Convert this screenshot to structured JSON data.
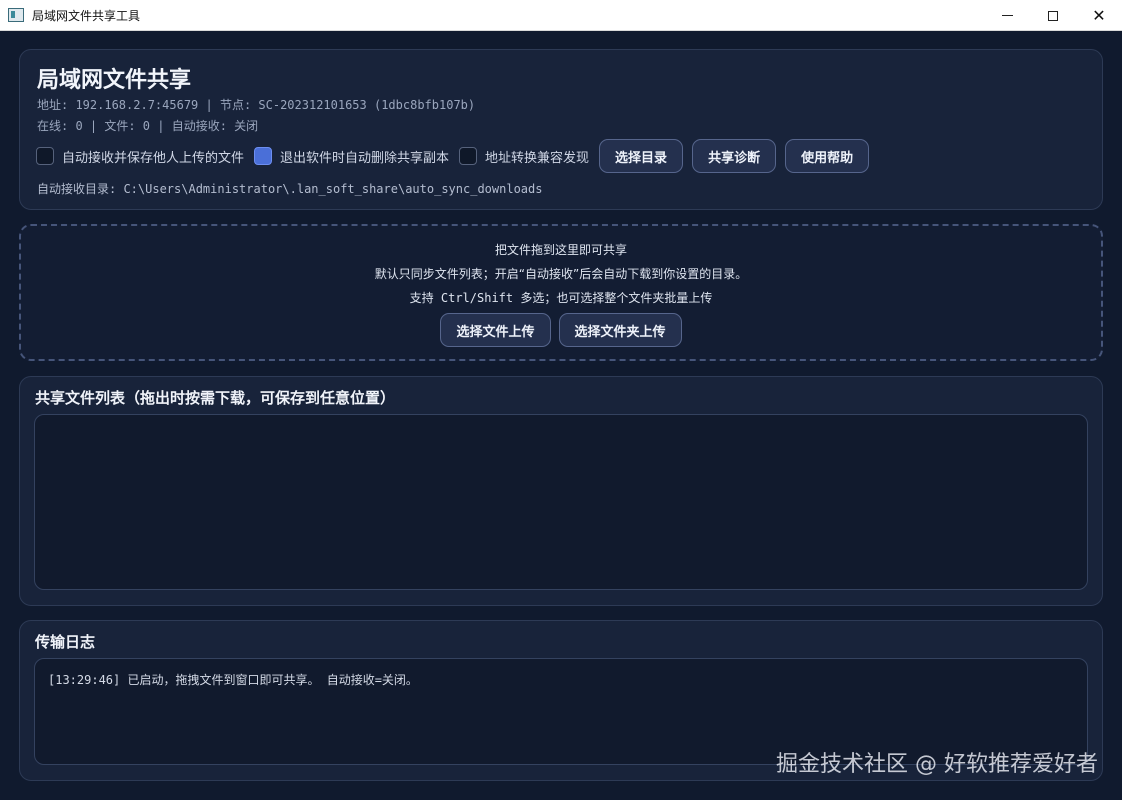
{
  "window": {
    "title": "局域网文件共享工具",
    "controls": {
      "minimize": "—",
      "maximize": "☐",
      "close": "✕"
    }
  },
  "header": {
    "title": "局域网文件共享",
    "address_line": "地址: 192.168.2.7:45679 | 节点: SC-202312101653 (1dbc8bfb107b)",
    "status_line": "在线: 0 | 文件: 0 | 自动接收: 关闭",
    "options": [
      {
        "label": "自动接收并保存他人上传的文件",
        "checked": false
      },
      {
        "label": "退出软件时自动删除共享副本",
        "checked": true
      },
      {
        "label": "地址转换兼容发现",
        "checked": false
      }
    ],
    "buttons": {
      "choose_dir": "选择目录",
      "share_diagnose": "共享诊断",
      "help": "使用帮助"
    },
    "auto_dir_line": "自动接收目录: C:\\Users\\Administrator\\.lan_soft_share\\auto_sync_downloads"
  },
  "drop_zone": {
    "title": "把文件拖到这里即可共享",
    "description": "默认只同步文件列表；开启“自动接收”后会自动下载到你设置的目录。",
    "tip": "支持 Ctrl/Shift 多选；也可选择整个文件夹批量上传",
    "buttons": {
      "upload_files": "选择文件上传",
      "upload_folder": "选择文件夹上传"
    }
  },
  "files_section": {
    "title": "共享文件列表（拖出时按需下载，可保存到任意位置）",
    "items": []
  },
  "log_section": {
    "title": "传输日志",
    "entries": [
      "[13:29:46] 已启动，拖拽文件到窗口即可共享。 自动接收=关闭。"
    ]
  },
  "watermark": "掘金技术社区 @ 好软推荐爱好者",
  "colors": {
    "background": "#101a2e",
    "panel": "#18233a",
    "checkbox_on": "#4a6fd8",
    "button": "#24304e"
  }
}
